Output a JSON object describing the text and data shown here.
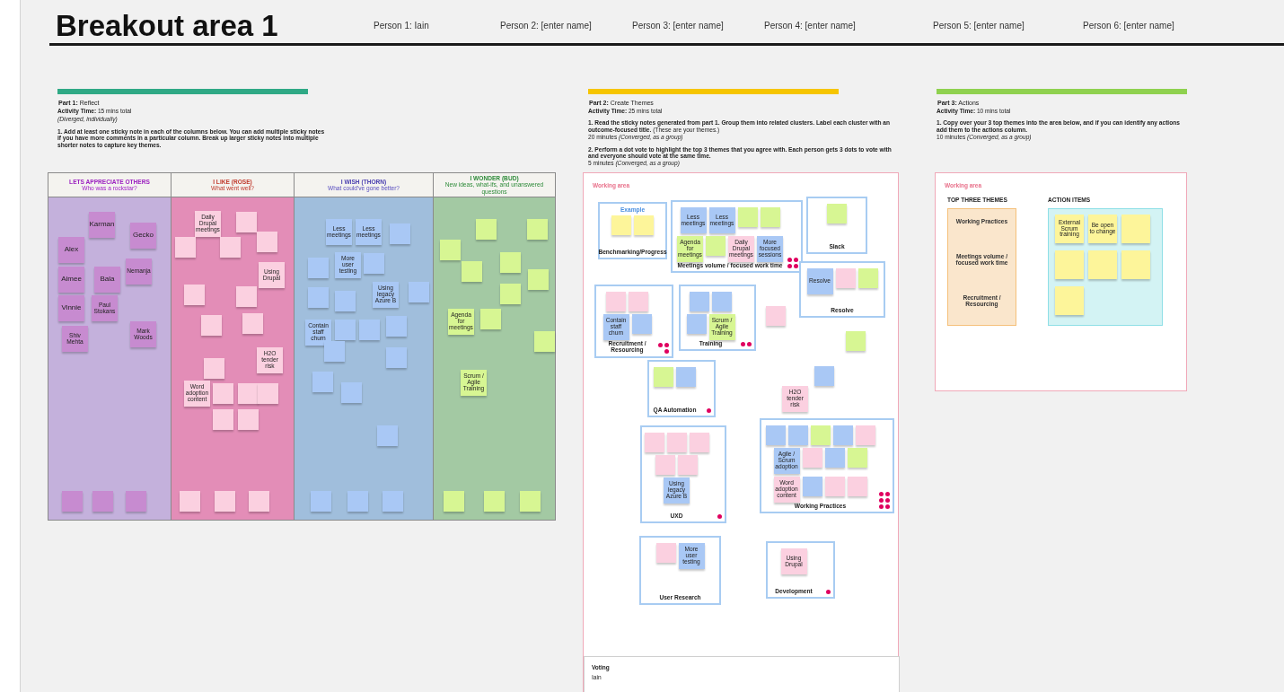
{
  "title": "Breakout area 1",
  "people": [
    "Person 1: Iain",
    "Person 2: [enter name]",
    "Person 3: [enter name]",
    "Person 4: [enter name]",
    "Person 5: [enter name]",
    "Person 6: [enter name]"
  ],
  "part1": {
    "heading": "**Part 1:** Reflect",
    "color": "#2fa985",
    "lines": [
      "**Activity Time:** 15 mins total",
      "*(Diverged, individually)*"
    ],
    "instructions": [
      "**1. Add at least one sticky note in each of the columns below. You can add multiple sticky notes if you have more comments in a particular column. Break up larger sticky notes into multiple shorter notes to capture key themes.**"
    ],
    "columns": [
      {
        "title": "LETS APPRECIATE OTHERS",
        "subtitle": "Who was a rockstar?",
        "color": "#c4b1dc",
        "notes": [
          {
            "text": "Karman",
            "color": "#c78bd0"
          },
          {
            "text": "Gecko",
            "color": "#c78bd0"
          },
          {
            "text": "Alex",
            "color": "#c78bd0"
          },
          {
            "text": "Nemanja",
            "color": "#c78bd0"
          },
          {
            "text": "Aimee",
            "color": "#c78bd0"
          },
          {
            "text": "Bala",
            "color": "#c78bd0"
          },
          {
            "text": "Vinnie",
            "color": "#c78bd0"
          },
          {
            "text": "Paul Stokans",
            "color": "#c78bd0"
          },
          {
            "text": "Mark Woods",
            "color": "#c78bd0"
          },
          {
            "text": "Shiv Mehta",
            "color": "#c78bd0"
          },
          {
            "color": "#c78bd0"
          },
          {
            "color": "#c78bd0"
          },
          {
            "color": "#c78bd0"
          }
        ]
      },
      {
        "title": "I LIKE (ROSE)",
        "subtitle": "What went well?",
        "color": "#e38db7",
        "notes": [
          {
            "text": "Daily Drupal meetings",
            "color": "#fbd0e0"
          },
          {
            "color": "#fbd0e0"
          },
          {
            "color": "#fbd0e0"
          },
          {
            "color": "#fbd0e0"
          },
          {
            "color": "#fbd0e0"
          },
          {
            "text": "Using Drupal",
            "color": "#fbd0e0"
          },
          {
            "color": "#fbd0e0"
          },
          {
            "color": "#fbd0e0"
          },
          {
            "color": "#fbd0e0"
          },
          {
            "color": "#fbd0e0"
          },
          {
            "text": "H2O tender risk",
            "color": "#fbd0e0"
          },
          {
            "color": "#fbd0e0"
          },
          {
            "text": "Word adoption content",
            "color": "#fbd0e0"
          },
          {
            "color": "#fbd0e0"
          },
          {
            "color": "#fbd0e0"
          },
          {
            "color": "#fbd0e0"
          },
          {
            "color": "#fbd0e0"
          },
          {
            "color": "#fbd0e0"
          },
          {
            "color": "#fbd0e0"
          },
          {
            "color": "#fbd0e0"
          },
          {
            "color": "#fbd0e0"
          }
        ]
      },
      {
        "title": "I WISH (THORN)",
        "subtitle": "What could've gone better?",
        "color": "#a0bedc",
        "notes": [
          {
            "text": "Less meetings",
            "color": "#a9c8f5"
          },
          {
            "text": "Less meetings",
            "color": "#a9c8f5"
          },
          {
            "color": "#a9c8f5"
          },
          {
            "color": "#a9c8f5"
          },
          {
            "text": "More user testing",
            "color": "#a9c8f5"
          },
          {
            "color": "#a9c8f5"
          },
          {
            "color": "#a9c8f5"
          },
          {
            "color": "#a9c8f5"
          },
          {
            "text": "Using legacy Azure B",
            "color": "#a9c8f5"
          },
          {
            "color": "#a9c8f5"
          },
          {
            "text": "Contain staff churn",
            "color": "#a9c8f5"
          },
          {
            "color": "#a9c8f5"
          },
          {
            "color": "#a9c8f5"
          },
          {
            "color": "#a9c8f5"
          },
          {
            "color": "#a9c8f5"
          },
          {
            "color": "#a9c8f5"
          },
          {
            "color": "#a9c8f5"
          },
          {
            "color": "#a9c8f5"
          },
          {
            "color": "#a9c8f5"
          },
          {
            "color": "#a9c8f5"
          },
          {
            "color": "#a9c8f5"
          },
          {
            "color": "#a9c8f5"
          }
        ]
      },
      {
        "title": "I WONDER (BUD)",
        "subtitle": "New ideas, what-ifs, and unanswered questions",
        "color": "#a3c9a3",
        "notes": [
          {
            "color": "#d7f693"
          },
          {
            "color": "#d7f693"
          },
          {
            "color": "#d7f693"
          },
          {
            "color": "#d7f693"
          },
          {
            "color": "#d7f693"
          },
          {
            "color": "#d7f693"
          },
          {
            "color": "#d7f693"
          },
          {
            "text": "Agenda for meetings",
            "color": "#d7f693"
          },
          {
            "color": "#d7f693"
          },
          {
            "color": "#d7f693"
          },
          {
            "text": "Scrum / Agile Training",
            "color": "#d7f693"
          },
          {
            "color": "#d7f693"
          },
          {
            "color": "#d7f693"
          },
          {
            "color": "#d7f693"
          }
        ]
      }
    ]
  },
  "part2": {
    "heading": "**Part 2:** Create Themes",
    "color": "#f6c500",
    "lines": [
      "**Activity Time:** 25 mins total"
    ],
    "instructions": [
      "**1. Read the sticky notes generated from part 1. Group them into related clusters. Label each cluster with an outcome-focused title.** (These are your themes.)",
      "20 minutes *(Converged, as a group)*",
      "**2. Perform a dot vote to highlight the top 3 themes that you agree with. Each person gets 3 dots to vote with and everyone should vote at the same time.**",
      "5 minutes *(Converged, as a group)*"
    ],
    "working_area": "Working area",
    "clusters": [
      {
        "heading": "Example",
        "label": "Benchmarking/Progress",
        "notes": [
          {
            "color": "#fdf59a"
          },
          {
            "color": "#fdf59a"
          }
        ]
      },
      {
        "label": "Meetings volume / focused work time",
        "votes": [
          {
            "kind": "dot"
          },
          {
            "kind": "dot"
          },
          {
            "kind": "dot"
          },
          {
            "kind": "dot"
          }
        ],
        "notes": [
          {
            "text": "Less meetings",
            "color": "#a9c8f5"
          },
          {
            "text": "Less meetings",
            "color": "#a9c8f5"
          },
          {
            "color": "#d7f693"
          },
          {
            "color": "#d7f693"
          },
          {
            "text": "Agenda for meetings",
            "color": "#d7f693"
          },
          {
            "color": "#d7f693"
          },
          {
            "text": "Daily Drupal meetings",
            "color": "#fbd0e0"
          },
          {
            "text": "More focused sessions",
            "color": "#a9c8f5"
          }
        ]
      },
      {
        "label": "Slack",
        "notes": [
          {
            "color": "#d7f693"
          }
        ]
      },
      {
        "label": "Recruitment / Resourcing",
        "votes": [
          {
            "kind": "dot"
          },
          {
            "kind": "dot"
          },
          {
            "kind": "dot"
          }
        ],
        "notes": [
          {
            "color": "#fbd0e0"
          },
          {
            "color": "#fbd0e0"
          },
          {
            "text": "Contain staff churn",
            "color": "#a9c8f5"
          },
          {
            "color": "#a9c8f5"
          }
        ]
      },
      {
        "label": "Training",
        "votes": [
          {
            "kind": "dot"
          },
          {
            "kind": "dot"
          }
        ],
        "notes": [
          {
            "color": "#a9c8f5"
          },
          {
            "color": "#a9c8f5"
          },
          {
            "color": "#a9c8f5"
          },
          {
            "text": "Scrum / Agile Training",
            "color": "#d7f693"
          }
        ]
      },
      {
        "label": "Resolve",
        "notes": [
          {
            "text": "Resolve",
            "color": "#a9c8f5"
          },
          {
            "color": "#fbd0e0"
          },
          {
            "color": "#d7f693"
          }
        ]
      },
      {
        "label": "QA Automation",
        "votes": [
          {
            "kind": "dot"
          }
        ],
        "notes": [
          {
            "color": "#d7f693"
          },
          {
            "color": "#a9c8f5"
          }
        ]
      },
      {
        "label": "UXD",
        "votes": [
          {
            "kind": "dot"
          }
        ],
        "notes": [
          {
            "color": "#fbd0e0"
          },
          {
            "color": "#fbd0e0"
          },
          {
            "color": "#fbd0e0"
          },
          {
            "color": "#fbd0e0"
          },
          {
            "color": "#fbd0e0"
          },
          {
            "text": "Using legacy Azure B",
            "color": "#a9c8f5"
          }
        ]
      },
      {
        "label": "User Research",
        "notes": [
          {
            "color": "#fbd0e0"
          },
          {
            "text": "More user testing",
            "color": "#a9c8f5"
          }
        ]
      },
      {
        "label": "Working Practices",
        "votes": [
          {
            "kind": "dot"
          },
          {
            "kind": "dot"
          },
          {
            "kind": "dot"
          },
          {
            "kind": "dot"
          },
          {
            "kind": "dot"
          },
          {
            "kind": "dot"
          }
        ],
        "notes": [
          {
            "color": "#a9c8f5"
          },
          {
            "color": "#a9c8f5"
          },
          {
            "color": "#d7f693"
          },
          {
            "color": "#a9c8f5"
          },
          {
            "color": "#fbd0e0"
          },
          {
            "text": "Agile / Scrum adoption",
            "color": "#a9c8f5"
          },
          {
            "color": "#fbd0e0"
          },
          {
            "color": "#a9c8f5"
          },
          {
            "color": "#d7f693"
          },
          {
            "text": "Word adoption content",
            "color": "#fbd0e0"
          },
          {
            "color": "#a9c8f5"
          },
          {
            "color": "#fbd0e0"
          },
          {
            "color": "#fbd0e0"
          }
        ]
      },
      {
        "label": "Development",
        "votes": [
          {
            "kind": "dot"
          }
        ],
        "notes": [
          {
            "text": "Using Drupal",
            "color": "#fbd0e0"
          }
        ]
      }
    ],
    "loose_notes": [
      {
        "color": "#fbd0e0"
      },
      {
        "color": "#d7f693"
      },
      {
        "color": "#a9c8f5"
      },
      {
        "text": "H2O tender risk",
        "color": "#fbd0e0"
      }
    ],
    "voting": {
      "title": "Voting",
      "names": [
        "Iain"
      ]
    }
  },
  "part3": {
    "heading": "**Part 3:** Actions",
    "color": "#8fd14f",
    "lines": [
      "**Activity Time:** 10 mins total"
    ],
    "instructions": [
      "**1. Copy over your 3 top themes into the area below, and if you can identify any actions add them to the actions column.**",
      "10 minutes *(Converged, as a group)*"
    ],
    "working_area": "Working area",
    "themes_title": "TOP THREE THEMES",
    "themes": [
      "Working Practices",
      "Meetings volume / focused work time",
      "Recruitment / Resourcing"
    ],
    "actions_title": "ACTION ITEMS",
    "actions": [
      {
        "text": "External Scrum training",
        "color": "#fdf59a"
      },
      {
        "text": "Be open to change",
        "color": "#fdf59a"
      },
      {
        "color": "#fdf59a"
      },
      {
        "color": "#fdf59a"
      },
      {
        "color": "#fdf59a"
      },
      {
        "color": "#fdf59a"
      },
      {
        "color": "#fdf59a"
      }
    ]
  }
}
